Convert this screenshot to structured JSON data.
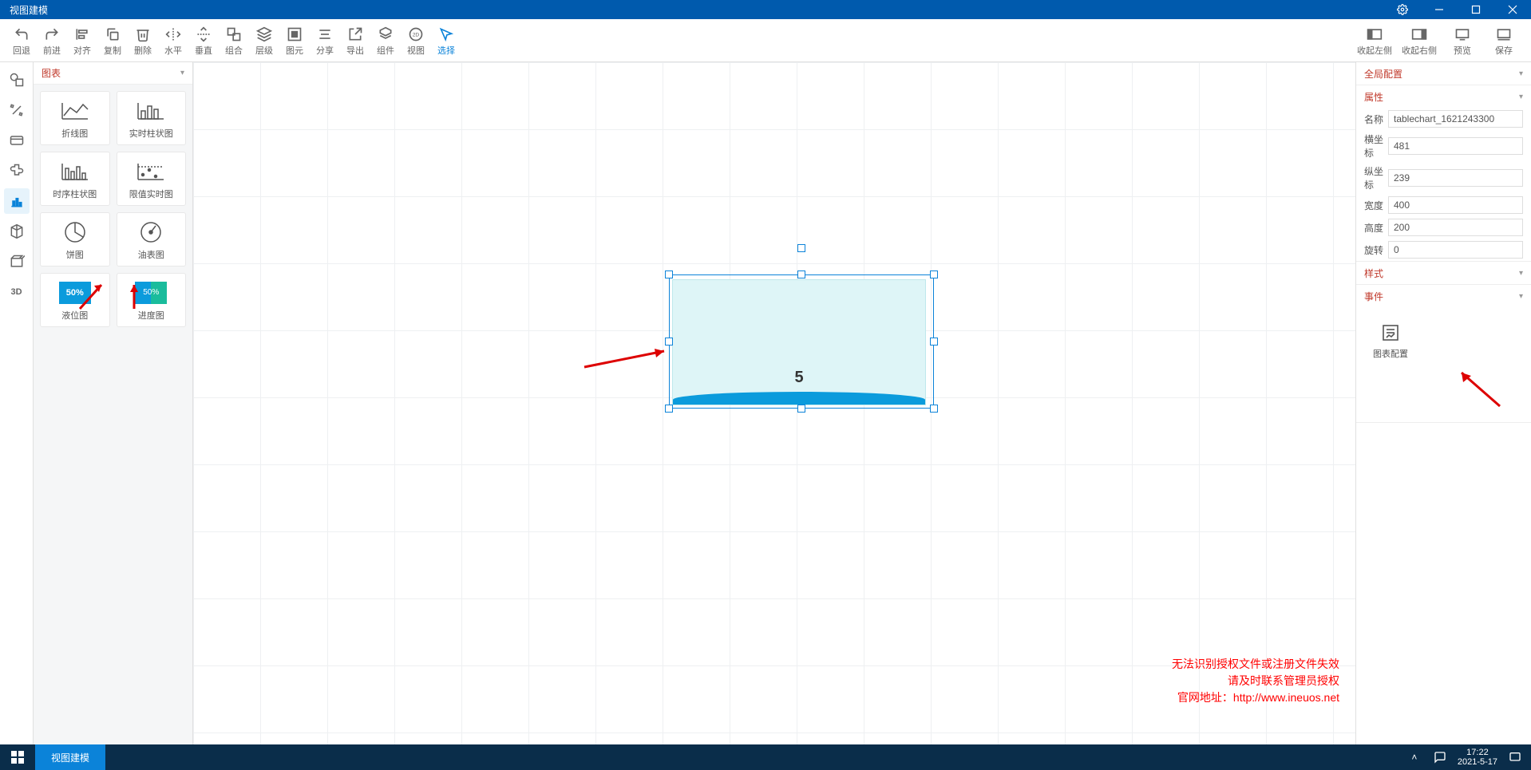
{
  "title": "视图建模",
  "toolbar": {
    "left": [
      {
        "id": "undo",
        "label": "回退"
      },
      {
        "id": "redo",
        "label": "前进"
      },
      {
        "id": "align",
        "label": "对齐"
      },
      {
        "id": "copy",
        "label": "复制"
      },
      {
        "id": "delete",
        "label": "删除"
      },
      {
        "id": "horiz",
        "label": "水平"
      },
      {
        "id": "vert",
        "label": "垂直"
      },
      {
        "id": "group",
        "label": "组合"
      },
      {
        "id": "layer",
        "label": "层级"
      },
      {
        "id": "pixel",
        "label": "图元"
      },
      {
        "id": "share",
        "label": "分享"
      },
      {
        "id": "export",
        "label": "导出"
      },
      {
        "id": "component",
        "label": "组件"
      },
      {
        "id": "view",
        "label": "视图"
      },
      {
        "id": "select",
        "label": "选择"
      }
    ],
    "right": [
      {
        "id": "collapse-left",
        "label": "收起左侧"
      },
      {
        "id": "collapse-right",
        "label": "收起右侧"
      },
      {
        "id": "preview",
        "label": "预览"
      },
      {
        "id": "save",
        "label": "保存"
      }
    ]
  },
  "palette": {
    "header": "图表",
    "items": [
      {
        "id": "line",
        "label": "折线图"
      },
      {
        "id": "rtbar",
        "label": "实时柱状图"
      },
      {
        "id": "tsb",
        "label": "时序柱状图"
      },
      {
        "id": "limit",
        "label": "限值实时图"
      },
      {
        "id": "pie",
        "label": "饼图"
      },
      {
        "id": "gauge",
        "label": "油表图"
      },
      {
        "id": "liquid",
        "label": "液位图"
      },
      {
        "id": "progress",
        "label": "进度图"
      }
    ]
  },
  "canvas": {
    "selected_value": "5"
  },
  "props": {
    "global_header": "全局配置",
    "attr_header": "属性",
    "style_header": "样式",
    "event_header": "事件",
    "fields": {
      "name_label": "名称",
      "name_value": "tablechart_1621243300",
      "x_label": "横坐标",
      "x_value": "481",
      "y_label": "纵坐标",
      "y_value": "239",
      "w_label": "宽度",
      "w_value": "400",
      "h_label": "高度",
      "h_value": "200",
      "r_label": "旋转",
      "r_value": "0"
    },
    "event_btn": "图表配置"
  },
  "license": {
    "line1": "无法识别授权文件或注册文件失效",
    "line2": "请及时联系管理员授权",
    "line3_prefix": "官网地址：",
    "line3_url": "http://www.ineuos.net"
  },
  "taskbar": {
    "task": "视图建模",
    "time": "17:22",
    "date": "2021-5-17"
  }
}
